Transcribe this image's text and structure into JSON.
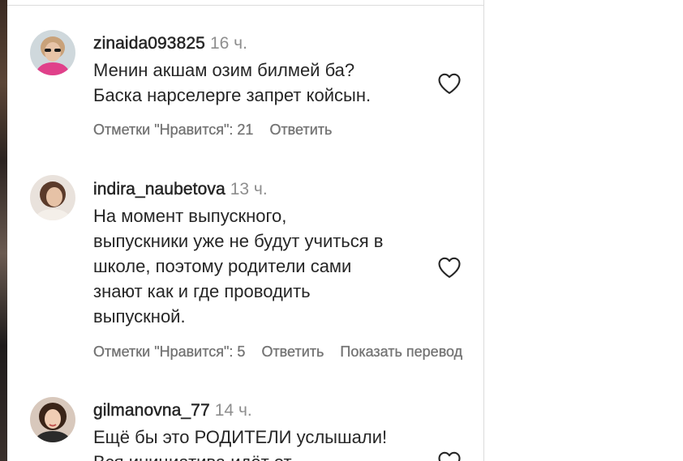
{
  "comments": [
    {
      "username": "zinaida093825",
      "time": "16 ч.",
      "text": "Менин акшам озим билмей ба?\nБаска нарселерге запрет койсын.",
      "likes": "Отметки \"Нравится\": 21",
      "reply": "Ответить"
    },
    {
      "username": "indira_naubetova",
      "time": "13 ч.",
      "text": "На момент выпускного,\nвыпускники уже не будут учиться в\nшколе, поэтому родители сами\nзнают как и где проводить\nвыпускной.",
      "likes": "Отметки \"Нравится\": 5",
      "reply": "Ответить",
      "show_translation": "Показать перевод"
    },
    {
      "username": "gilmanovna_77",
      "time": "14 ч.",
      "text": "Ещё бы это РОДИТЕЛИ услышали!\nВся инициатива идёт от"
    }
  ],
  "colors": {
    "text": "#262626",
    "secondary": "#8e8e8e",
    "action": "#737373",
    "divider": "#dbdbdb"
  }
}
